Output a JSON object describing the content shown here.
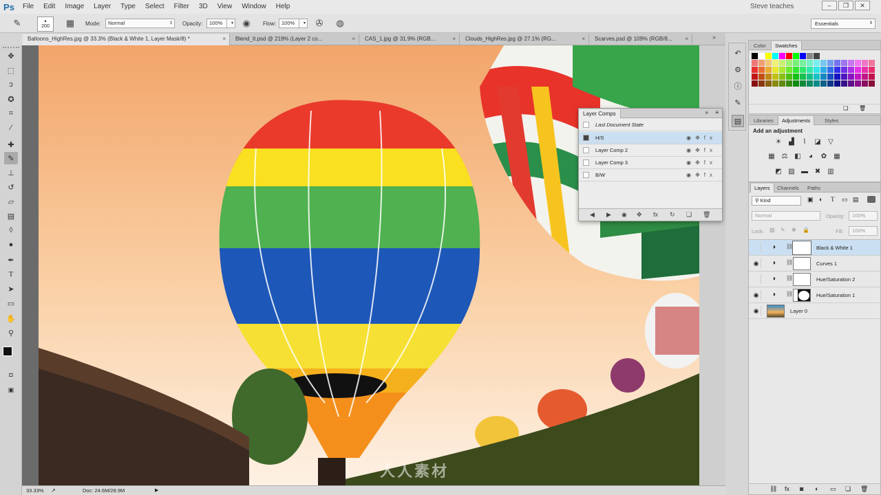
{
  "app": {
    "logo": "Ps",
    "menu": [
      "File",
      "Edit",
      "Image",
      "Layer",
      "Type",
      "Select",
      "Filter",
      "3D",
      "View",
      "Window",
      "Help"
    ],
    "user": "Steve teaches",
    "window_controls": [
      "–",
      "❐",
      "✕"
    ]
  },
  "options": {
    "brush_size": "200",
    "mode_label": "Mode:",
    "mode_value": "Normal",
    "opacity_label": "Opacity:",
    "opacity_value": "100%",
    "flow_label": "Flow:",
    "flow_value": "100%",
    "workspace": "Essentials"
  },
  "tabs": [
    {
      "label": "Balloons_HighRes.jpg @ 33.3% (Black & White 1, Layer Mask/8) *",
      "active": true
    },
    {
      "label": "Blend_It.psd @ 219% (Layer 2 co...",
      "active": false
    },
    {
      "label": "CAS_1.jpg @ 31.9% (RGB...",
      "active": false
    },
    {
      "label": "Clouds_HighRes.jpg @ 27.1% (RG...",
      "active": false
    },
    {
      "label": "Scarves.psd @ 109% (RGB/8...",
      "active": false
    }
  ],
  "tools": [
    "move-tool",
    "marquee-tool",
    "lasso-tool",
    "quick-select-tool",
    "crop-tool",
    "eyedropper-tool",
    "healing-tool",
    "brush-tool",
    "stamp-tool",
    "history-brush-tool",
    "eraser-tool",
    "gradient-tool",
    "blur-tool",
    "dodge-tool",
    "pen-tool",
    "type-tool",
    "path-select-tool",
    "shape-tool",
    "hand-tool",
    "zoom-tool"
  ],
  "status": {
    "zoom": "33.33%",
    "doc": "Doc: 24.6M/28.9M"
  },
  "layer_comps": {
    "title": "Layer Comps",
    "last_state": "Last Document State",
    "rows": [
      {
        "name": "H/S",
        "selected": true
      },
      {
        "name": "Layer Comp 2",
        "selected": false
      },
      {
        "name": "Layer Comp 3",
        "selected": false
      },
      {
        "name": "B/W",
        "selected": false
      }
    ]
  },
  "color_panel": {
    "tabs": [
      "Color",
      "Swatches"
    ],
    "active_tab": "Swatches"
  },
  "adjustments_panel": {
    "tabs": [
      "Libraries",
      "Adjustments",
      "Styles"
    ],
    "active_tab": "Adjustments",
    "heading": "Add an adjustment"
  },
  "layers_panel": {
    "tabs": [
      "Layers",
      "Channels",
      "Paths"
    ],
    "active_tab": "Layers",
    "filter": "Kind",
    "blend_mode": "Normal",
    "opacity_label": "Opacity:",
    "opacity_value": "100%",
    "lock_label": "Lock:",
    "fill_label": "Fill:",
    "fill_value": "100%",
    "layers": [
      {
        "name": "Black & White 1",
        "visible": false,
        "selected": true,
        "kind": "adjustment"
      },
      {
        "name": "Curves 1",
        "visible": true,
        "selected": false,
        "kind": "adjustment"
      },
      {
        "name": "Hue/Saturation 2",
        "visible": false,
        "selected": false,
        "kind": "adjustment"
      },
      {
        "name": "Hue/Saturation 1",
        "visible": true,
        "selected": false,
        "kind": "adjustment-masked"
      },
      {
        "name": "Layer 0",
        "visible": true,
        "selected": false,
        "kind": "image"
      }
    ]
  },
  "watermark": "人人素材",
  "colors": {
    "accent": "#1d6ea8",
    "selection": "#cadff1",
    "panel_bg": "#e8e8e8"
  }
}
